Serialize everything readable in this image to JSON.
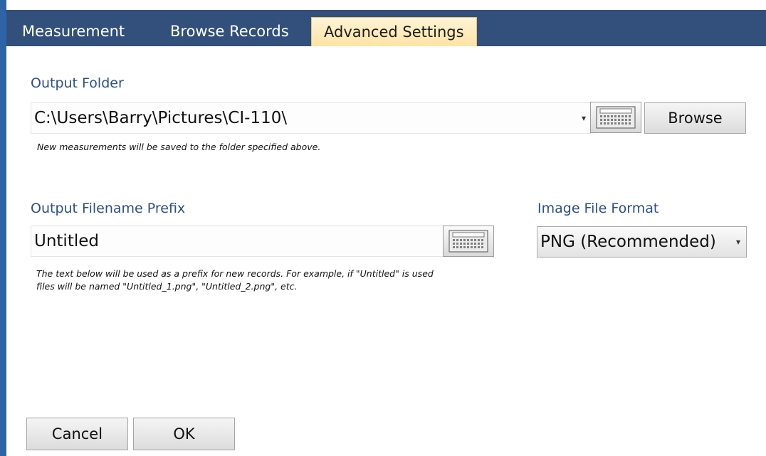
{
  "tabs": [
    {
      "label": "Measurement"
    },
    {
      "label": "Browse Records"
    },
    {
      "label": "Advanced Settings"
    }
  ],
  "output_folder": {
    "label": "Output Folder",
    "value": "C:\\Users\\Barry\\Pictures\\CI-110\\",
    "browse_label": "Browse",
    "hint": "New measurements will be saved to the folder specified above."
  },
  "filename_prefix": {
    "label": "Output Filename Prefix",
    "value": "Untitled",
    "hint_line1": "The text below will be used as a prefix for new records.  For example, if \"Untitled\" is used",
    "hint_line2": "files will be named \"Untitled_1.png\", \"Untitled_2.png\", etc."
  },
  "image_format": {
    "label": "Image File Format",
    "selected": "PNG (Recommended)"
  },
  "footer": {
    "cancel_label": "Cancel",
    "ok_label": "OK"
  },
  "icons": {
    "keyboard": "keyboard-icon",
    "dropdown": "dropdown-caret-icon"
  },
  "colors": {
    "tabbar": "#33507c",
    "active_tab": "#ffe3a4",
    "label_blue": "#2c4f8a",
    "left_border": "#2f63a7"
  }
}
